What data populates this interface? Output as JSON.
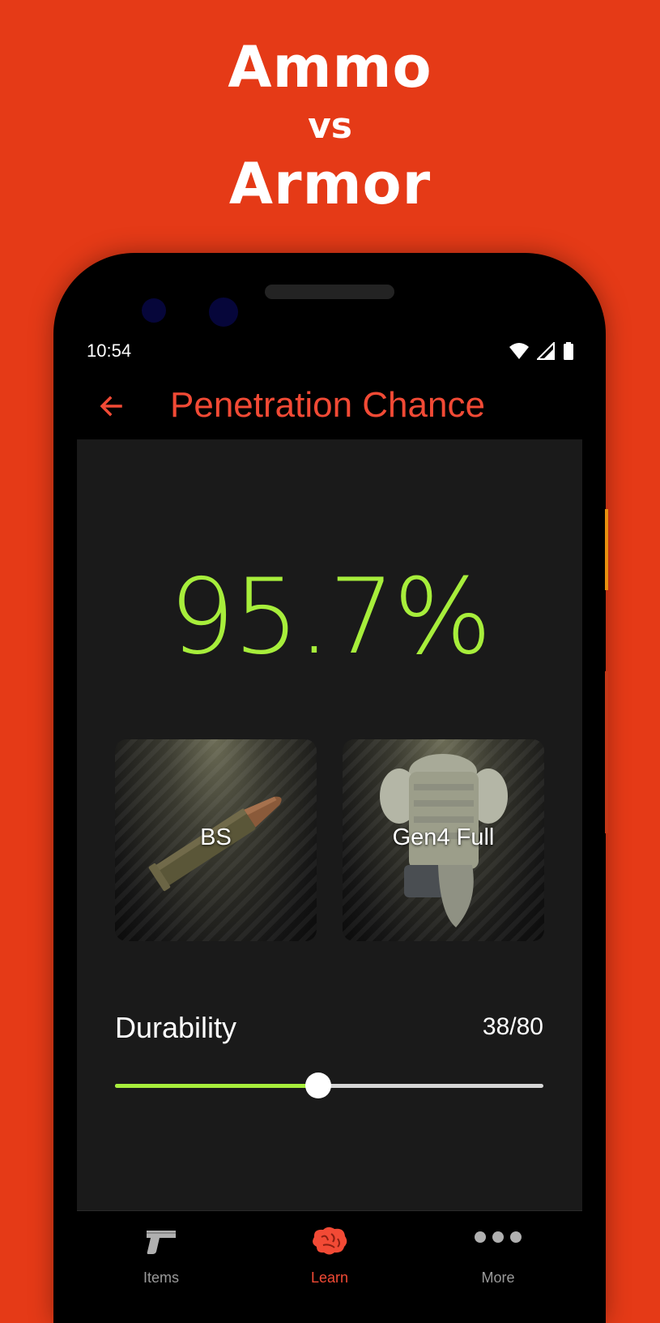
{
  "promo": {
    "line1": "Ammo",
    "line2": "vs",
    "line3": "Armor"
  },
  "status_bar": {
    "time": "10:54",
    "icons": [
      "wifi-icon",
      "signal-icon",
      "battery-icon"
    ]
  },
  "app_bar": {
    "back_icon": "arrow-left-icon",
    "title": "Penetration Chance"
  },
  "result": {
    "penetration_chance": "95.7%"
  },
  "cards": {
    "ammo": {
      "label": "BS",
      "icon": "bullet-icon"
    },
    "armor": {
      "label": "Gen4 Full",
      "icon": "armor-vest-icon"
    }
  },
  "durability": {
    "label": "Durability",
    "value_text": "38/80",
    "current": 38,
    "max": 80
  },
  "bottom_nav": {
    "items": [
      {
        "label": "Items",
        "icon": "pistol-icon",
        "active": false
      },
      {
        "label": "Learn",
        "icon": "brain-icon",
        "active": true
      },
      {
        "label": "More",
        "icon": "more-dots-icon",
        "active": false
      }
    ]
  },
  "colors": {
    "background": "#E53A17",
    "accent": "#F24A35",
    "success": "#A7EE3B",
    "surface": "#1a1a1a"
  }
}
